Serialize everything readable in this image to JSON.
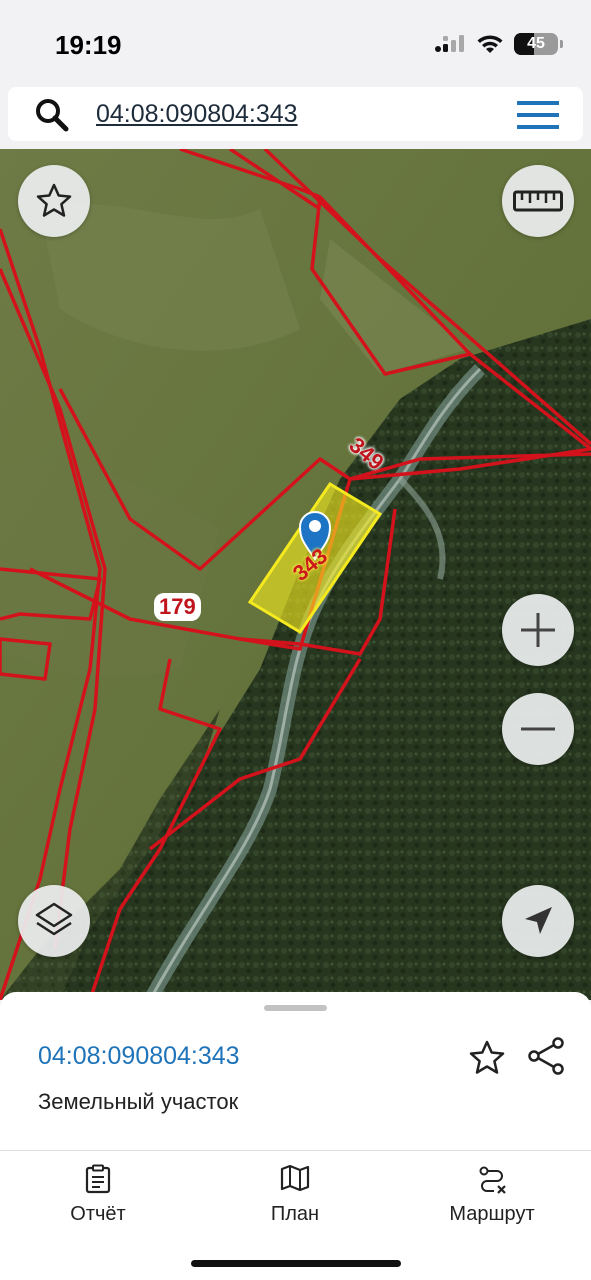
{
  "status_bar": {
    "time": "19:19",
    "battery_level": "45",
    "battery_fraction": 0.45,
    "icons": [
      "cellular-signal-icon",
      "wifi-icon",
      "battery-icon"
    ]
  },
  "search": {
    "value": "04:08:090804:343",
    "icon": "search-icon",
    "menu_icon": "hamburger-menu-icon"
  },
  "map": {
    "parcel_labels": {
      "p349": "349",
      "p179": "179",
      "p343": "343"
    },
    "buttons": [
      "star-icon",
      "ruler-icon",
      "zoom-in-icon",
      "zoom-out-icon",
      "layers-icon",
      "locate-icon"
    ],
    "colors": {
      "parcel_border": "#d4121c",
      "selected_fill": "#f4ea1f",
      "pin": "#1d74c4"
    }
  },
  "sheet": {
    "title": "04:08:090804:343",
    "subtitle": "Земельный участок"
  },
  "nav": {
    "report": "Отчёт",
    "plan": "План",
    "route": "Маршрут"
  },
  "colors": {
    "accent": "#1f74b9",
    "menu_icon": "#1f74b9"
  }
}
